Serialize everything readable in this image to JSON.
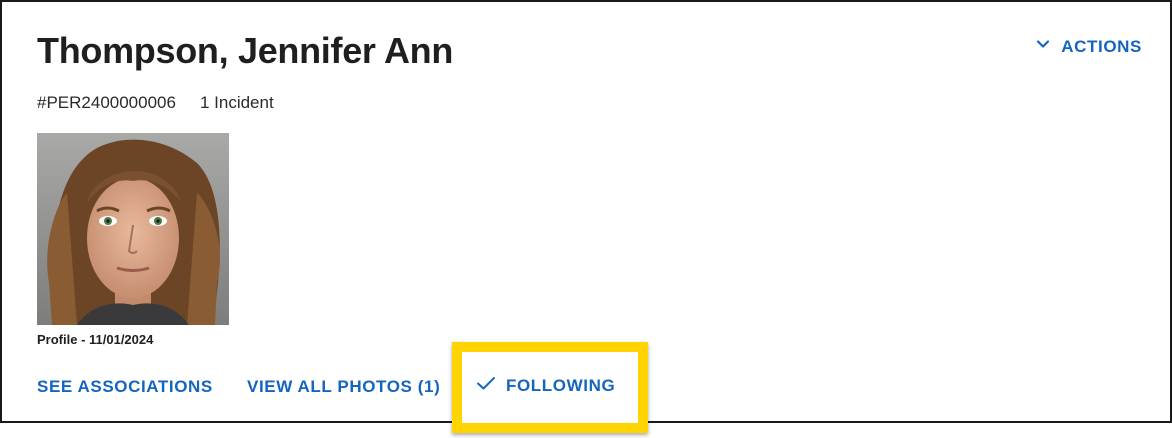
{
  "person": {
    "name": "Thompson, Jennifer Ann",
    "record_id": "#PER2400000006",
    "incident_count": "1 Incident"
  },
  "header": {
    "actions_label": "ACTIONS",
    "actions_icon": "chevron-down-icon"
  },
  "photo": {
    "caption": "Profile - 11/01/2024"
  },
  "links": {
    "see_associations": "SEE ASSOCIATIONS",
    "view_all_photos": "VIEW ALL PHOTOS (1)",
    "following": "FOLLOWING",
    "following_icon": "check-icon"
  },
  "colors": {
    "accent": "#1565c0",
    "highlight": "#ffd400",
    "text": "#1f1f1f"
  }
}
